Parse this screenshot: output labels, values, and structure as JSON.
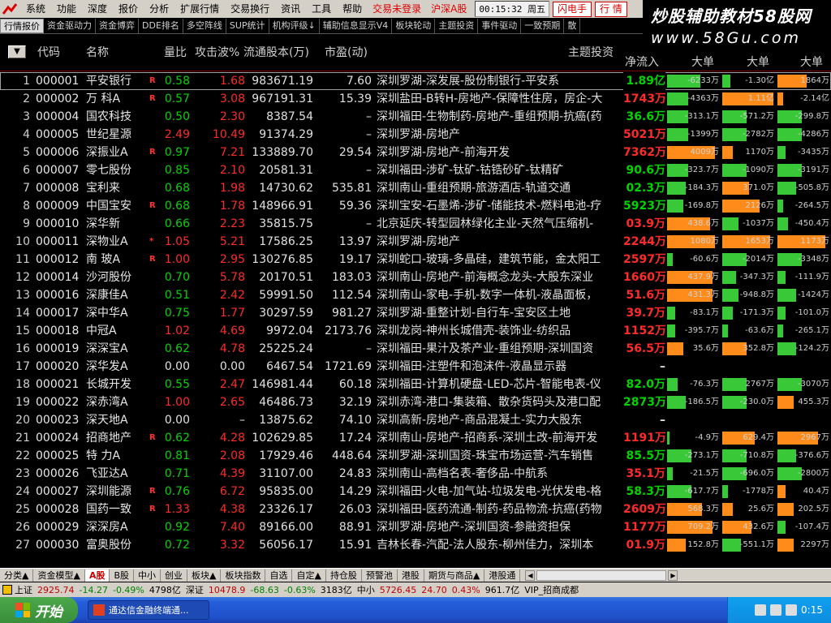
{
  "menubar": {
    "items": [
      "系统",
      "功能",
      "深度",
      "报价",
      "分析",
      "扩展行情",
      "交易换行",
      "资讯",
      "工具",
      "帮助"
    ],
    "status_red": [
      "交易未登录",
      "沪深A股"
    ],
    "clock": "00:15:32 周五",
    "buttons": [
      "闪电手",
      "行 情"
    ]
  },
  "banner": {
    "line1": "炒股辅助教材58股网",
    "line2": "www.58Gu.com"
  },
  "toolbar": {
    "items": [
      "行情报价",
      "资金驱动力",
      "资金博弈",
      "DDE排名",
      "多空阵线",
      "SUP统计",
      "机构评级↓",
      "辅助信息显示V4",
      "板块轮动",
      "主题投资",
      "事件驱动",
      "一致预期",
      "散"
    ]
  },
  "grid": {
    "headers": {
      "sort": "▼",
      "code": "代码",
      "name": "名称",
      "vol_ratio": "量比",
      "attack": "攻击波%",
      "float_shares": "流通股本(万)",
      "pe": "市盈(动)",
      "theme": "主题投资",
      "net_flow": "净流入",
      "big1": "大单",
      "big2": "大单",
      "big3": "大单"
    },
    "rows": [
      {
        "idx": "1",
        "code": "000001",
        "name": "平安银行",
        "flag": "R",
        "vr": "0.58",
        "vr_c": "dn",
        "atk": "1.68",
        "atk_c": "up",
        "float": "983671.19",
        "pe": "7.60",
        "theme": "深圳罗湖-深发展-股份制银行-平安系",
        "net": "1.89亿",
        "net_c": "dn",
        "b1": "-6233万",
        "b1v": -0.62,
        "b2": "-1.30亿",
        "b2v": -0.15,
        "b3": "1864万",
        "b3v": 0.55
      },
      {
        "idx": "2",
        "code": "000002",
        "name": "万 科A",
        "flag": "R",
        "vr": "0.57",
        "vr_c": "dn",
        "atk": "3.08",
        "atk_c": "up",
        "float": "967191.31",
        "pe": "15.39",
        "theme": "深圳盐田-B转H-房地产-保障性住房，房企-大",
        "net": "1743万",
        "net_c": "up",
        "b1": "-4363万",
        "b1v": -0.4,
        "b2": "1.11亿",
        "b2v": 0.95,
        "b3": "-2.14亿",
        "b3v": 0.1
      },
      {
        "idx": "3",
        "code": "000004",
        "name": "国农科技",
        "flag": "",
        "vr": "0.50",
        "vr_c": "dn",
        "atk": "2.30",
        "atk_c": "up",
        "float": "8387.54",
        "pe": "–",
        "theme": "深圳福田-生物制药-房地产-重组预期-抗癌(药",
        "net": "36.6万",
        "net_c": "dn",
        "b1": "-313.1万",
        "b1v": -0.4,
        "b2": "-571.2万",
        "b2v": -0.45,
        "b3": "-299.8万",
        "b3v": -0.45
      },
      {
        "idx": "4",
        "code": "000005",
        "name": "世纪星源",
        "flag": "",
        "vr": "2.49",
        "vr_c": "up",
        "atk": "10.49",
        "atk_c": "up",
        "float": "91374.29",
        "pe": "–",
        "theme": "深圳罗湖-房地产",
        "net": "5021万",
        "net_c": "up",
        "b1": "-1399万",
        "b1v": -0.4,
        "b2": "-2782万",
        "b2v": -0.45,
        "b3": "-4286万",
        "b3v": -0.45
      },
      {
        "idx": "5",
        "code": "000006",
        "name": "深振业A",
        "flag": "R",
        "vr": "0.97",
        "vr_c": "dn",
        "atk": "7.21",
        "atk_c": "up",
        "float": "133889.70",
        "pe": "29.54",
        "theme": "深圳罗湖-房地产-前海开发",
        "net": "7362万",
        "net_c": "up",
        "b1": "4009万",
        "b1v": 0.9,
        "b2": "1170万",
        "b2v": 0.2,
        "b3": "-3435万",
        "b3v": -0.15
      },
      {
        "idx": "6",
        "code": "000007",
        "name": "零七股份",
        "flag": "",
        "vr": "0.85",
        "vr_c": "dn",
        "atk": "2.10",
        "atk_c": "up",
        "float": "20581.31",
        "pe": "–",
        "theme": "深圳福田-涉矿-钛矿-钴锆砂矿-钛精矿",
        "net": "90.6万",
        "net_c": "dn",
        "b1": "-323.7万",
        "b1v": -0.4,
        "b2": "-1090万",
        "b2v": -0.45,
        "b3": "-3191万",
        "b3v": -0.45
      },
      {
        "idx": "7",
        "code": "000008",
        "name": "宝利来",
        "flag": "",
        "vr": "0.68",
        "vr_c": "dn",
        "atk": "1.98",
        "atk_c": "up",
        "float": "14730.62",
        "pe": "535.81",
        "theme": "深圳南山-重组预期-旅游酒店-轨道交通",
        "net": "02.3万",
        "net_c": "dn",
        "b1": "-184.3万",
        "b1v": -0.35,
        "b2": "371.0万",
        "b2v": 0.5,
        "b3": "-505.8万",
        "b3v": -0.35
      },
      {
        "idx": "8",
        "code": "000009",
        "name": "中国宝安",
        "flag": "R",
        "vr": "0.68",
        "vr_c": "dn",
        "atk": "1.78",
        "atk_c": "up",
        "float": "148966.91",
        "pe": "59.36",
        "theme": "深圳宝安-石墨烯-涉矿-储能技术-燃料电池-疗",
        "net": "5923万",
        "net_c": "dn",
        "b1": "-169.8万",
        "b1v": -0.3,
        "b2": "2126万",
        "b2v": 0.7,
        "b3": "-264.5万",
        "b3v": -0.1
      },
      {
        "idx": "9",
        "code": "000010",
        "name": "深华新",
        "flag": "",
        "vr": "0.66",
        "vr_c": "dn",
        "atk": "2.23",
        "atk_c": "up",
        "float": "35815.75",
        "pe": "–",
        "theme": "北京延庆-转型园林绿化主业-天然气压缩机-",
        "net": "03.9万",
        "net_c": "up",
        "b1": "438.6万",
        "b1v": 0.8,
        "b2": "-1037万",
        "b2v": -0.3,
        "b3": "-450.4万",
        "b3v": -0.2
      },
      {
        "idx": "10",
        "code": "000011",
        "name": "深物业A",
        "flag": "*",
        "vr": "1.05",
        "vr_c": "up",
        "atk": "5.21",
        "atk_c": "up",
        "float": "17586.25",
        "pe": "13.97",
        "theme": "深圳罗湖-房地产",
        "net": "2244万",
        "net_c": "up",
        "b1": "1080万",
        "b1v": 0.9,
        "b2": "1653万",
        "b2v": 0.9,
        "b3": "1173万",
        "b3v": 0.9
      },
      {
        "idx": "11",
        "code": "000012",
        "name": "南 玻A",
        "flag": "R",
        "vr": "1.00",
        "vr_c": "up",
        "atk": "2.95",
        "atk_c": "up",
        "float": "130276.85",
        "pe": "19.17",
        "theme": "深圳蛇口-玻璃-多晶硅，建筑节能，金太阳工",
        "net": "2597万",
        "net_c": "up",
        "b1": "-60.6万",
        "b1v": -0.1,
        "b2": "-2014万",
        "b2v": -0.45,
        "b3": "-3348万",
        "b3v": -0.45
      },
      {
        "idx": "12",
        "code": "000014",
        "name": "沙河股份",
        "flag": "",
        "vr": "0.70",
        "vr_c": "dn",
        "atk": "5.78",
        "atk_c": "up",
        "float": "20170.51",
        "pe": "183.03",
        "theme": "深圳南山-房地产-前海概念龙头-大股东深业",
        "net": "1660万",
        "net_c": "up",
        "b1": "437.9万",
        "b1v": 0.85,
        "b2": "-347.3万",
        "b2v": -0.25,
        "b3": "-111.9万",
        "b3v": -0.15
      },
      {
        "idx": "13",
        "code": "000016",
        "name": "深康佳A",
        "flag": "",
        "vr": "0.51",
        "vr_c": "dn",
        "atk": "2.42",
        "atk_c": "up",
        "float": "59991.50",
        "pe": "112.54",
        "theme": "深圳南山-家电-手机-数字一体机-液晶面板，",
        "net": "51.6万",
        "net_c": "up",
        "b1": "431.3万",
        "b1v": 0.85,
        "b2": "-948.8万",
        "b2v": -0.3,
        "b3": "-1424万",
        "b3v": -0.35
      },
      {
        "idx": "14",
        "code": "000017",
        "name": "深中华A",
        "flag": "",
        "vr": "0.75",
        "vr_c": "dn",
        "atk": "1.77",
        "atk_c": "up",
        "float": "30297.59",
        "pe": "981.27",
        "theme": "深圳罗湖-重整计划-自行车-宝安区土地",
        "net": "39.7万",
        "net_c": "up",
        "b1": "-83.1万",
        "b1v": -0.15,
        "b2": "-171.3万",
        "b2v": -0.2,
        "b3": "-101.0万",
        "b3v": -0.15
      },
      {
        "idx": "15",
        "code": "000018",
        "name": "中冠A",
        "flag": "",
        "vr": "1.02",
        "vr_c": "up",
        "atk": "4.69",
        "atk_c": "up",
        "float": "9972.04",
        "pe": "2173.76",
        "theme": "深圳龙岗-神州长城借壳-装饰业-纺织品",
        "net": "1152万",
        "net_c": "up",
        "b1": "-395.7万",
        "b1v": -0.15,
        "b2": "-63.6万",
        "b2v": -0.1,
        "b3": "-265.1万",
        "b3v": -0.1
      },
      {
        "idx": "16",
        "code": "000019",
        "name": "深深宝A",
        "flag": "",
        "vr": "0.62",
        "vr_c": "dn",
        "atk": "4.78",
        "atk_c": "up",
        "float": "25225.24",
        "pe": "–",
        "theme": "深圳福田-果汁及茶产业-重组预期-深圳国资",
        "net": "56.5万",
        "net_c": "up",
        "b1": "35.6万",
        "b1v": 0.3,
        "b2": "352.8万",
        "b2v": 0.45,
        "b3": "-124.2万",
        "b3v": -0.35
      },
      {
        "idx": "17",
        "code": "000020",
        "name": "深华发A",
        "flag": "",
        "vr": "0.00",
        "vr_c": "eq",
        "atk": "0.00",
        "atk_c": "eq",
        "float": "6467.54",
        "pe": "1721.69",
        "theme": "深圳福田-注塑件和泡沫件-液晶显示器",
        "net": "–",
        "net_c": "eq",
        "b1": "",
        "b1v": 0,
        "b2": "",
        "b2v": 0,
        "b3": "",
        "b3v": 0
      },
      {
        "idx": "18",
        "code": "000021",
        "name": "长城开发",
        "flag": "",
        "vr": "0.55",
        "vr_c": "dn",
        "atk": "2.47",
        "atk_c": "up",
        "float": "146981.44",
        "pe": "60.18",
        "theme": "深圳福田-计算机硬盘-LED-芯片-智能电表-仪",
        "net": "82.0万",
        "net_c": "dn",
        "b1": "-76.3万",
        "b1v": -0.2,
        "b2": "2767万",
        "b2v": -0.45,
        "b3": "-3070万",
        "b3v": -0.45
      },
      {
        "idx": "19",
        "code": "000022",
        "name": "深赤湾A",
        "flag": "",
        "vr": "1.00",
        "vr_c": "up",
        "atk": "2.65",
        "atk_c": "up",
        "float": "46486.73",
        "pe": "32.19",
        "theme": "深圳赤湾-港口-集装箱、散杂货码头及港口配",
        "net": "2873万",
        "net_c": "dn",
        "b1": "-186.5万",
        "b1v": -0.35,
        "b2": "-230.0万",
        "b2v": -0.45,
        "b3": "455.3万",
        "b3v": 0.3
      },
      {
        "idx": "20",
        "code": "000023",
        "name": "深天地A",
        "flag": "",
        "vr": "0.00",
        "vr_c": "eq",
        "atk": "–",
        "atk_c": "eq",
        "float": "13875.62",
        "pe": "74.10",
        "theme": "深圳高新-房地产-商品混凝土-实力大股东",
        "net": "–",
        "net_c": "eq",
        "b1": "",
        "b1v": 0,
        "b2": "",
        "b2v": 0,
        "b3": "",
        "b3v": 0
      },
      {
        "idx": "21",
        "code": "000024",
        "name": "招商地产",
        "flag": "R",
        "vr": "0.62",
        "vr_c": "dn",
        "atk": "4.28",
        "atk_c": "up",
        "float": "102629.85",
        "pe": "17.24",
        "theme": "深圳南山-房地产-招商系-深圳土改-前海开发",
        "net": "1191万",
        "net_c": "up",
        "b1": "-4.9万",
        "b1v": -0.05,
        "b2": "629.4万",
        "b2v": 0.6,
        "b3": "2967万",
        "b3v": 0.75
      },
      {
        "idx": "22",
        "code": "000025",
        "name": "特 力A",
        "flag": "",
        "vr": "0.81",
        "vr_c": "dn",
        "atk": "2.08",
        "atk_c": "up",
        "float": "17929.46",
        "pe": "448.64",
        "theme": "深圳罗湖-深圳国资-珠宝市场运营-汽车销售",
        "net": "85.5万",
        "net_c": "dn",
        "b1": "-273.1万",
        "b1v": -0.45,
        "b2": "-710.8万",
        "b2v": -0.45,
        "b3": "-376.6万",
        "b3v": -0.35
      },
      {
        "idx": "23",
        "code": "000026",
        "name": "飞亚达A",
        "flag": "",
        "vr": "0.71",
        "vr_c": "dn",
        "atk": "4.39",
        "atk_c": "up",
        "float": "31107.00",
        "pe": "24.83",
        "theme": "深圳南山-高档名表-奢侈品-中航系",
        "net": "35.1万",
        "net_c": "up",
        "b1": "-21.5万",
        "b1v": -0.1,
        "b2": "-696.0万",
        "b2v": -0.45,
        "b3": "-2800万",
        "b3v": -0.45
      },
      {
        "idx": "24",
        "code": "000027",
        "name": "深圳能源",
        "flag": "R",
        "vr": "0.76",
        "vr_c": "dn",
        "atk": "6.72",
        "atk_c": "up",
        "float": "95835.00",
        "pe": "14.29",
        "theme": "深圳福田-火电-加气站-垃圾发电-光伏发电-格",
        "net": "58.3万",
        "net_c": "dn",
        "b1": "-617.7万",
        "b1v": -0.45,
        "b2": "-1778万",
        "b2v": -0.1,
        "b3": "40.4万",
        "b3v": 0.15
      },
      {
        "idx": "25",
        "code": "000028",
        "name": "国药一致",
        "flag": "R",
        "vr": "1.33",
        "vr_c": "up",
        "atk": "4.38",
        "atk_c": "up",
        "float": "23326.17",
        "pe": "26.03",
        "theme": "深圳福田-医药流通-制药-药品物流-抗癌(药物",
        "net": "2609万",
        "net_c": "up",
        "b1": "568.3万",
        "b1v": 0.65,
        "b2": "25.6万",
        "b2v": 0.2,
        "b3": "202.5万",
        "b3v": 0.3
      },
      {
        "idx": "26",
        "code": "000029",
        "name": "深深房A",
        "flag": "",
        "vr": "0.92",
        "vr_c": "dn",
        "atk": "7.40",
        "atk_c": "up",
        "float": "89166.00",
        "pe": "88.91",
        "theme": "深圳罗湖-房地产-深圳国资-参融资担保",
        "net": "1177万",
        "net_c": "up",
        "b1": "709.2万",
        "b1v": 0.85,
        "b2": "432.6万",
        "b2v": 0.55,
        "b3": "-107.4万",
        "b3v": -0.15
      },
      {
        "idx": "27",
        "code": "000030",
        "name": "富奥股份",
        "flag": "",
        "vr": "0.72",
        "vr_c": "dn",
        "atk": "3.32",
        "atk_c": "up",
        "float": "56056.17",
        "pe": "15.91",
        "theme": "吉林长春-汽配-法人股东-柳州佳力，深圳本",
        "net": "01.9万",
        "net_c": "up",
        "b1": "152.8万",
        "b1v": 0.35,
        "b2": "-551.1万",
        "b2v": -0.35,
        "b3": "2297万",
        "b3v": 0.3
      }
    ]
  },
  "tabs": {
    "items": [
      "分类▲",
      "资金模型▲",
      "A股",
      "B股",
      "中小",
      "创业",
      "板块▲",
      "板块指数",
      "自选",
      "自定▲",
      "持仓股",
      "预警池",
      "港股",
      "期货与商品▲",
      "港股通"
    ],
    "active_index": 2
  },
  "status": {
    "sh_label": "上证",
    "sh_val": "2925.74",
    "sh_chg": "-14.27",
    "sh_pct": "-0.49%",
    "sh_amt": "4798亿",
    "sz_label": "深证",
    "sz_val": "10478.9",
    "sz_chg": "-68.63",
    "sz_pct": "-0.63%",
    "sz_amt": "3183亿",
    "zx_label": "中小",
    "zx_val": "5726.45",
    "zx_chg": "24.70",
    "zx_pct": "0.43%",
    "zx_amt": "961.7亿",
    "vip": "VIP_招商成都"
  },
  "taskbar": {
    "start": "开始",
    "task": "通达信金融终端通...",
    "time": "0:15"
  },
  "colors": {
    "up": "#ff2a2a",
    "down": "#00d400",
    "bar_orange": "#ff8c1a",
    "bar_green": "#38c838"
  }
}
